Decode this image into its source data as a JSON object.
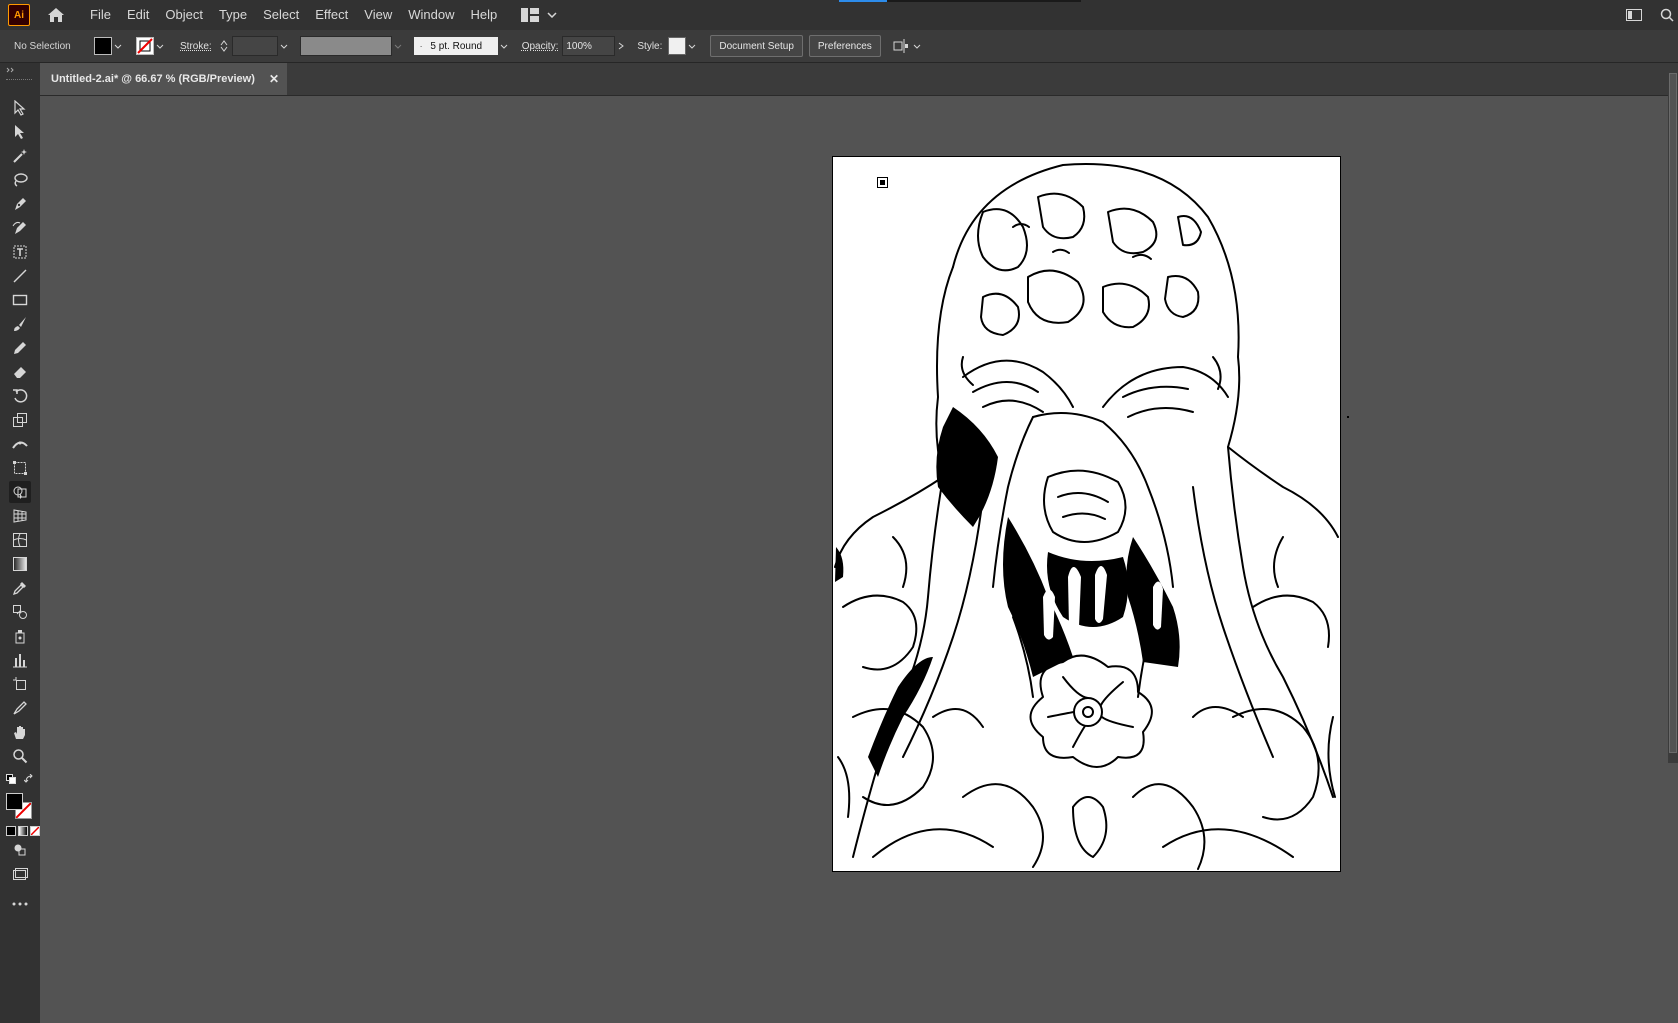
{
  "app": {
    "logo_text": "Ai",
    "menu": [
      "File",
      "Edit",
      "Object",
      "Type",
      "Select",
      "Effect",
      "View",
      "Window",
      "Help"
    ]
  },
  "control_bar": {
    "selection_label": "No Selection",
    "fill_color": "#000000",
    "stroke_label": "Stroke:",
    "brush_value": "5 pt. Round",
    "opacity_label": "Opacity:",
    "opacity_value": "100%",
    "style_label": "Style:",
    "document_setup_button": "Document Setup",
    "preferences_button": "Preferences"
  },
  "document": {
    "tab_title": "Untitled-2.ai* @ 66.67 % (RGB/Preview)"
  },
  "tools": [
    {
      "name": "selection-tool-icon"
    },
    {
      "name": "direct-selection-tool-icon"
    },
    {
      "name": "magic-wand-tool-icon"
    },
    {
      "name": "lasso-tool-icon"
    },
    {
      "name": "pen-tool-icon"
    },
    {
      "name": "curvature-tool-icon"
    },
    {
      "name": "type-area-tool-icon"
    },
    {
      "name": "line-segment-tool-icon"
    },
    {
      "name": "rectangle-tool-icon"
    },
    {
      "name": "paintbrush-tool-icon"
    },
    {
      "name": "pencil-tool-icon"
    },
    {
      "name": "eraser-tool-icon"
    },
    {
      "name": "rotate-tool-icon"
    },
    {
      "name": "scale-tool-icon"
    },
    {
      "name": "width-tool-icon"
    },
    {
      "name": "free-transform-tool-icon"
    },
    {
      "name": "shape-builder-tool-icon"
    },
    {
      "name": "perspective-grid-tool-icon"
    },
    {
      "name": "mesh-tool-icon"
    },
    {
      "name": "gradient-tool-icon"
    },
    {
      "name": "eyedropper-tool-icon"
    },
    {
      "name": "blend-tool-icon"
    },
    {
      "name": "symbol-sprayer-tool-icon"
    },
    {
      "name": "column-graph-tool-icon"
    },
    {
      "name": "artboard-tool-icon"
    },
    {
      "name": "slice-tool-icon"
    },
    {
      "name": "hand-tool-icon"
    },
    {
      "name": "zoom-tool-icon"
    }
  ],
  "colors": {
    "app_bg": "#535353",
    "menubar_bg": "#323232",
    "accent_orange": "#ff9a00",
    "accent_blue": "#2d8ceb"
  }
}
